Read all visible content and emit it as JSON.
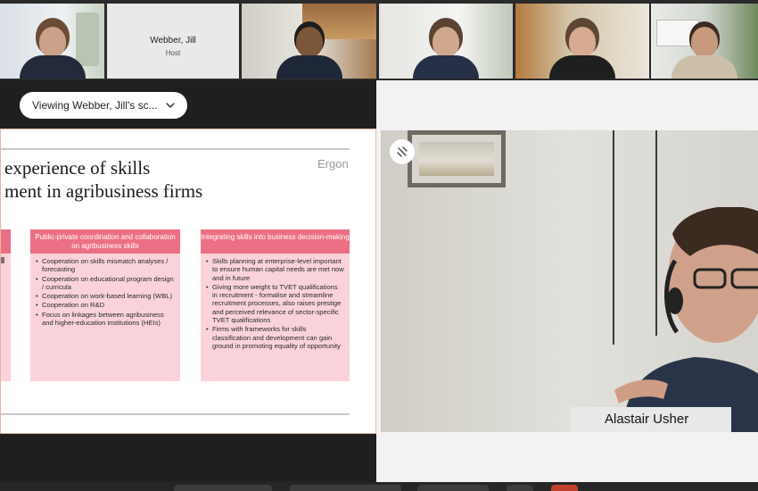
{
  "participants": {
    "host_tile": {
      "name": "Webber, Jill",
      "role": "Host"
    }
  },
  "share": {
    "viewing_label": "Viewing Webber, Jill's sc...",
    "slide": {
      "title_line1": "experience of skills",
      "title_line2": "ment in agribusiness firms",
      "brand": "Ergon",
      "columns": [
        {
          "header": "",
          "bullets": []
        },
        {
          "header": "Public-private coordination and collaboration on agribusiness skills",
          "bullets": [
            "Cooperation on skills mismatch analyses / forecasting",
            "Cooperation on educational program design / curricula",
            "Cooperation on work-based learning (WBL)",
            "Cooperation on R&D",
            "Focus on linkages between agribusiness and higher-education institutions (HEIs)"
          ]
        },
        {
          "header": "Integrating skills into business decision-making",
          "bullets": [
            "Skills planning at enterprise-level important to ensure human capital needs are met now and in future",
            "Giving more weight to TVET qualifications in recruitment - formalise and streamline recruitment processes, also raises prestige and perceived relevance of sector-specific TVET qualifications",
            "Firms with frameworks for skills classification and development can gain ground in promoting equality of opportunity"
          ]
        }
      ]
    }
  },
  "video": {
    "speaker_name": "Alastair Usher",
    "pin_icon": "unpin-icon"
  },
  "colors": {
    "header_pink": "#eb7085",
    "column_pink": "#f9d3d9",
    "app_dark": "#1f1f1f"
  }
}
